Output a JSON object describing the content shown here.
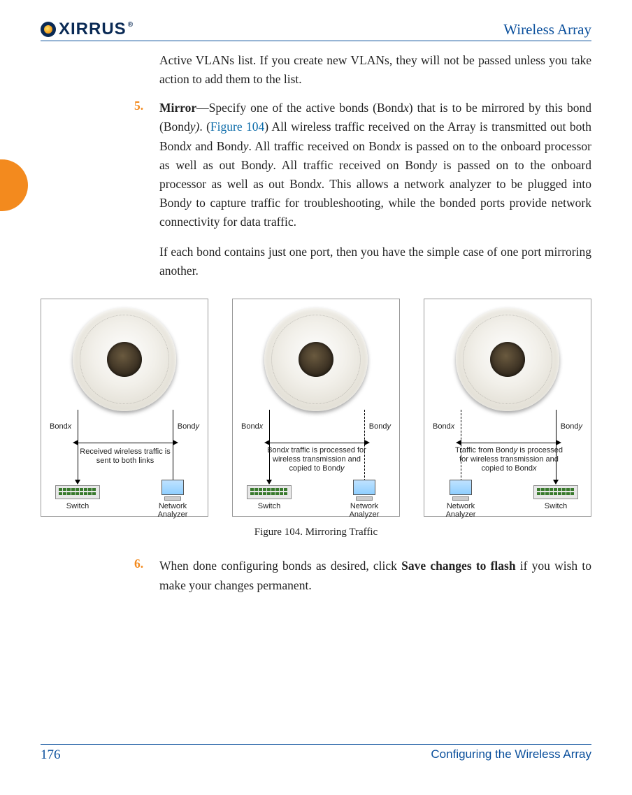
{
  "header": {
    "logo_text": "XIRRUS",
    "title": "Wireless Array"
  },
  "intro": "Active VLANs list. If you create new VLANs, they will not be passed unless you take action to add them to the list.",
  "item5": {
    "num": "5.",
    "heading": "Mirror",
    "text_a": "—Specify one of the active bonds (Bond",
    "x1": "x",
    "text_b": ") that is to be mirrored by this bond (Bond",
    "y1": "y)",
    "text_c": ". (",
    "figref": "Figure 104",
    "text_d": ") All wireless traffic received on the Array is transmitted out both Bond",
    "x2": "x",
    "text_e": " and Bond",
    "y2": "y",
    "text_f": ".   All traffic received on Bond",
    "x3": "x",
    "text_g": " is passed on to the onboard processor as well as out Bond",
    "y3": "y",
    "text_h": ". All traffic received on Bond",
    "y4": "y",
    "text_i": " is passed on to the onboard processor as well as out Bond",
    "x4": "x",
    "text_j": ". This allows a network analyzer to be plugged into Bond",
    "y5": "y",
    "text_k": " to capture traffic for troubleshooting, while the bonded ports provide network connectivity for data traffic.",
    "para2": "If each bond contains just one port, then you have the simple case of one port mirroring another."
  },
  "figure": {
    "caption": "Figure 104. Mirroring Traffic",
    "panels": [
      {
        "left_label_n": "Bond",
        "left_label_i": "x",
        "right_label_n": "Bond",
        "right_label_i": "y",
        "note": "Received wireless traffic is\nsent to both links",
        "dev_left": "Switch",
        "dev_right": "Network\nAnalyzer"
      },
      {
        "left_label_n": "Bond",
        "left_label_i": "x",
        "right_label_n": "Bond",
        "right_label_i": "y",
        "note_a": "Bond",
        "note_ai": "x",
        "note_b": " traffic is processed for\nwireless transmission and\ncopied to Bond",
        "note_bi": "y",
        "dev_left": "Switch",
        "dev_right": "Network\nAnalyzer"
      },
      {
        "left_label_n": "Bond",
        "left_label_i": "x",
        "right_label_n": "Bond",
        "right_label_i": "y",
        "note_a": "Traffic from Bond",
        "note_ai": "y",
        "note_b": " is processed\nfor wireless transmission and\ncopied to Bond",
        "note_bi": "x",
        "dev_left": "Network\nAnalyzer",
        "dev_right": "Switch"
      }
    ]
  },
  "item6": {
    "num": "6.",
    "text_a": "When done configuring bonds as desired, click ",
    "bold": "Save changes to flash",
    "text_b": " if you wish to make your changes permanent."
  },
  "footer": {
    "page": "176",
    "section": "Configuring the Wireless Array"
  }
}
